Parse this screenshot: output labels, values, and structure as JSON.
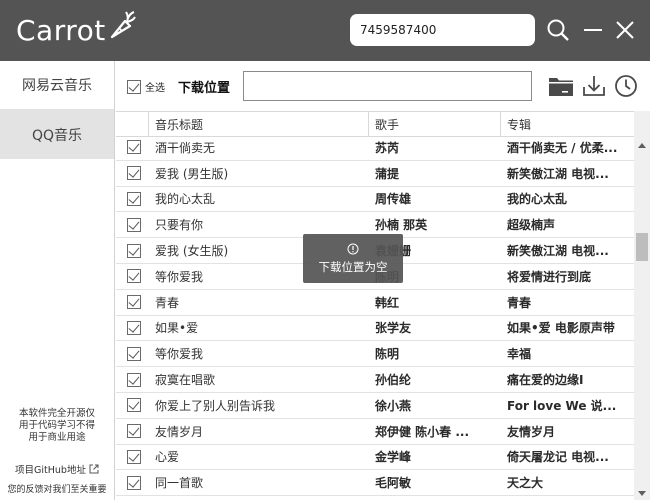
{
  "app": {
    "title": "Carrot"
  },
  "search": {
    "value": "7459587400"
  },
  "sidebar": {
    "items": [
      {
        "label": "网易云音乐",
        "active": false
      },
      {
        "label": "QQ音乐",
        "active": true
      }
    ],
    "notice": [
      "本软件完全开源仅",
      "用于代码学习不得",
      "用于商业用途"
    ],
    "github_link": "项目GitHub地址",
    "feedback": "您的反馈对我们至关重要"
  },
  "toolbar": {
    "select_all_label": "全选",
    "download_location_label": "下载位置",
    "download_path_value": ""
  },
  "table": {
    "headers": [
      "音乐标题",
      "歌手",
      "专辑"
    ],
    "rows": [
      {
        "title": "酒干倘卖无",
        "artist": "苏芮",
        "album": "酒干倘卖无 / 优柔..."
      },
      {
        "title": "爱我 (男生版)",
        "artist": "蒲提",
        "album": "新笑傲江湖 电视..."
      },
      {
        "title": "我的心太乱",
        "artist": "周传雄",
        "album": "我的心太乱"
      },
      {
        "title": "只要有你",
        "artist": "孙楠 那英",
        "album": "超级楠声"
      },
      {
        "title": "爱我 (女生版)",
        "artist": "袁姗姗",
        "album": "新笑傲江湖 电视..."
      },
      {
        "title": "等你爱我",
        "artist": "陈明",
        "album": "将爱情进行到底"
      },
      {
        "title": "青春",
        "artist": "韩红",
        "album": "青春"
      },
      {
        "title": "如果•爱",
        "artist": "张学友",
        "album": "如果•爱 电影原声带"
      },
      {
        "title": "等你爱我",
        "artist": "陈明",
        "album": "幸福"
      },
      {
        "title": "寂寞在唱歌",
        "artist": "孙伯纶",
        "album": "痛在爱的边缘I"
      },
      {
        "title": "你爱上了别人别告诉我",
        "artist": "徐小燕",
        "album": "For love We 说..."
      },
      {
        "title": "友情岁月",
        "artist": "郑伊健 陈小春 ...",
        "album": "友情岁月"
      },
      {
        "title": "心爱",
        "artist": "金学峰",
        "album": "倚天屠龙记 电视..."
      },
      {
        "title": "同一首歌",
        "artist": "毛阿敏",
        "album": "天之大"
      }
    ]
  },
  "toast": {
    "message": "下载位置为空"
  },
  "colors": {
    "titlebar": "#545454",
    "sidebar_active": "#e3e3e3",
    "toast_bg": "#555555"
  },
  "icons": [
    "carrot-icon",
    "search-icon",
    "minimize-icon",
    "close-icon",
    "folder-icon",
    "download-icon",
    "clock-icon",
    "external-link-icon",
    "info-icon"
  ]
}
